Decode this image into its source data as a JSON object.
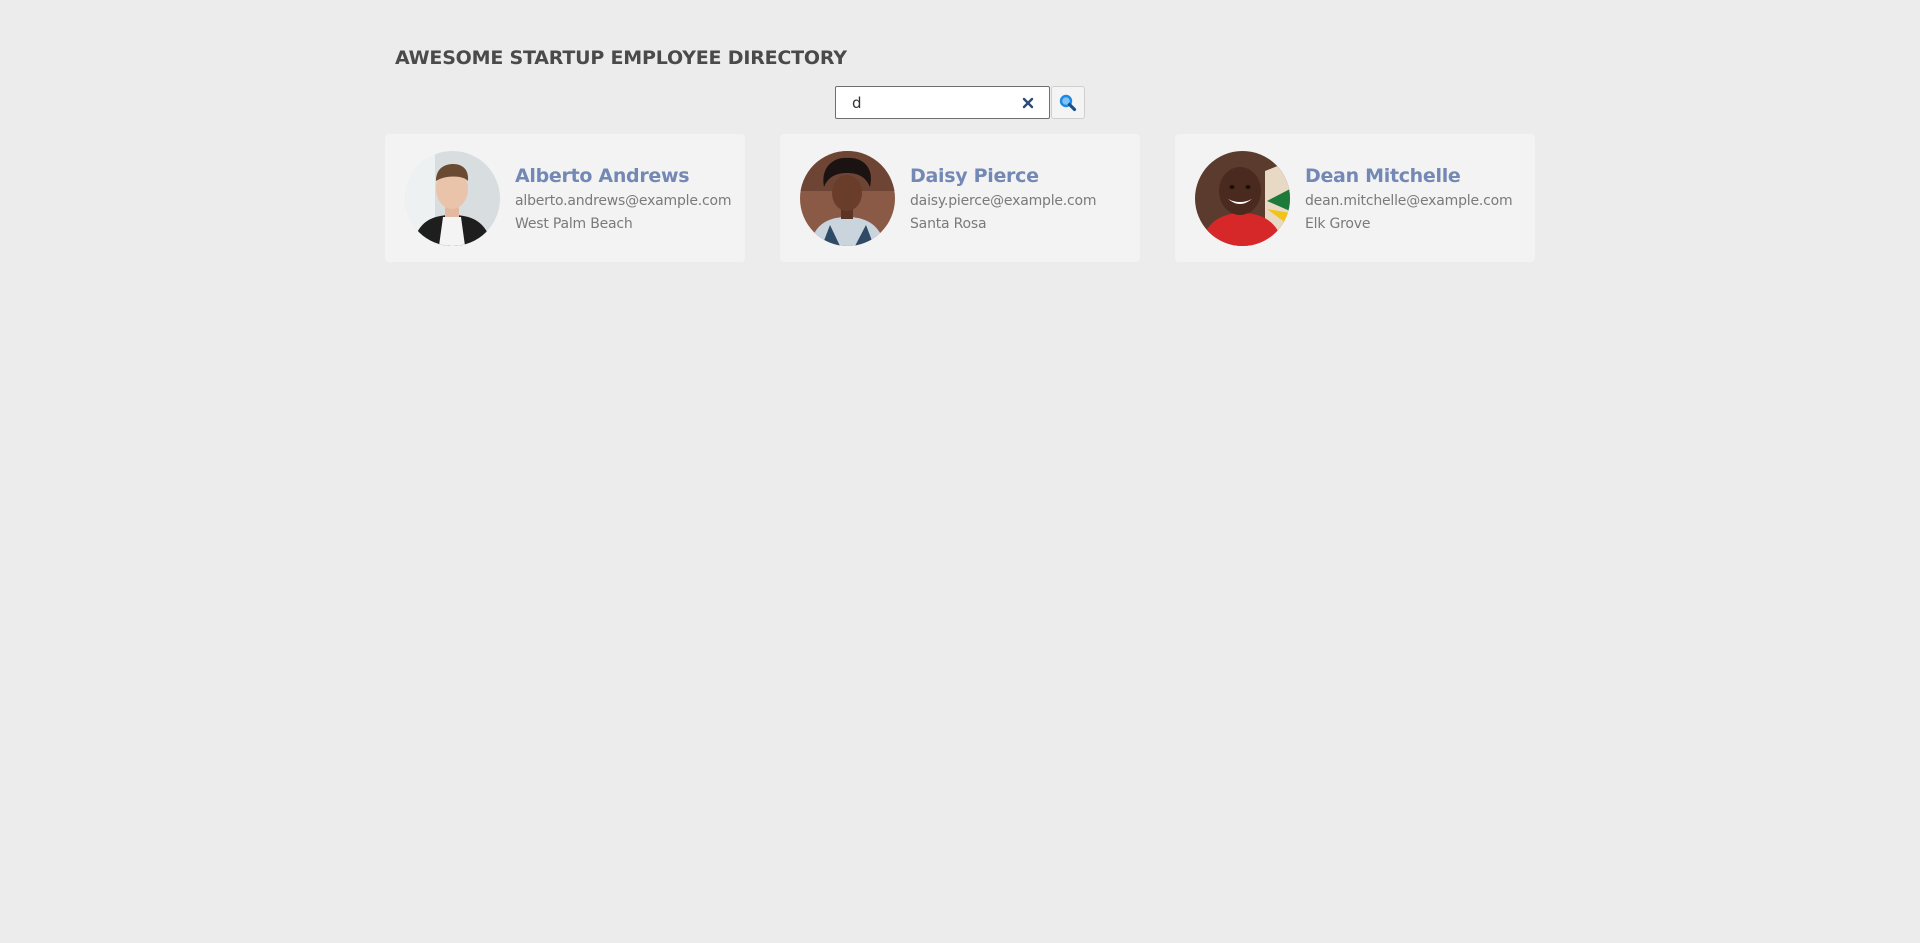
{
  "header": {
    "title": "AWESOME STARTUP EMPLOYEE DIRECTORY"
  },
  "search": {
    "value": "d",
    "clear_icon": "close-icon",
    "button_icon": "search-icon"
  },
  "employees": [
    {
      "name": "Alberto Andrews",
      "email": "alberto.andrews@example.com",
      "city": "West Palm Beach"
    },
    {
      "name": "Daisy Pierce",
      "email": "daisy.pierce@example.com",
      "city": "Santa Rosa"
    },
    {
      "name": "Dean Mitchelle",
      "email": "dean.mitchelle@example.com",
      "city": "Elk Grove"
    }
  ],
  "colors": {
    "background": "#ececec",
    "card": "#f3f3f3",
    "name_accent": "#7388b5",
    "clear_icon": "#2d4a7a",
    "search_icon": "#1e88e5"
  }
}
